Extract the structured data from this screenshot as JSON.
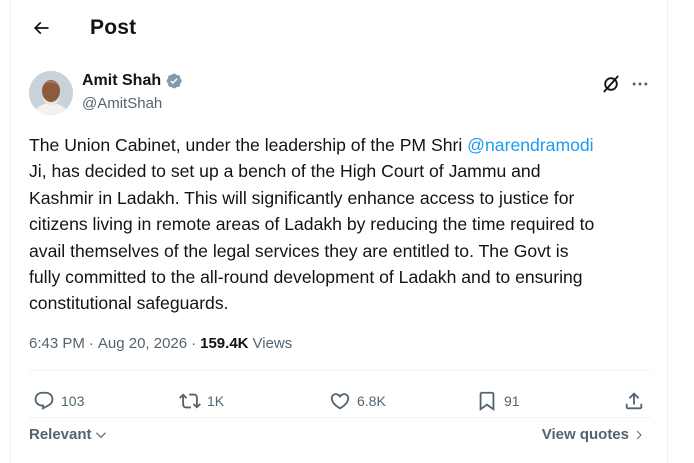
{
  "header": {
    "title": "Post"
  },
  "author": {
    "name": "Amit Shah",
    "handle": "@AmitShah"
  },
  "post": {
    "lines": [
      {
        "text": "The Union Cabinet, under the leadership of the PM Shri ",
        "mention": "@narendramodi"
      },
      {
        "text": "Ji, has decided to set up a bench of the High Court of Jammu and"
      },
      {
        "text": "Kashmir in Ladakh. This will significantly enhance access to justice for"
      },
      {
        "text": "citizens living in remote areas of Ladakh by reducing the time required to"
      },
      {
        "text": "avail themselves of the legal services they are entitled to. The Govt is"
      },
      {
        "text": "fully committed to the all-round development of Ladakh and to ensuring"
      },
      {
        "text": "constitutional safeguards."
      }
    ]
  },
  "meta": {
    "time": "6:43 PM",
    "separator": "·",
    "date": "Aug 20, 2026",
    "views_count": "159.4K",
    "views_label": "Views"
  },
  "actions": {
    "replies": "103",
    "reposts": "1K",
    "likes": "6.8K",
    "bookmarks": "91"
  },
  "footer": {
    "sort_label": "Relevant",
    "view_quotes": "View quotes"
  },
  "icons": [
    "back-arrow-icon",
    "verified-icon",
    "grok-icon",
    "more-icon",
    "reply-icon",
    "repost-icon",
    "like-icon",
    "bookmark-icon",
    "share-icon",
    "chevron-down-icon",
    "chevron-right-icon"
  ],
  "colors": {
    "accent": "#1d9bf0",
    "text": "#0f1419",
    "secondary": "#536471",
    "divider": "#eff3f4"
  }
}
